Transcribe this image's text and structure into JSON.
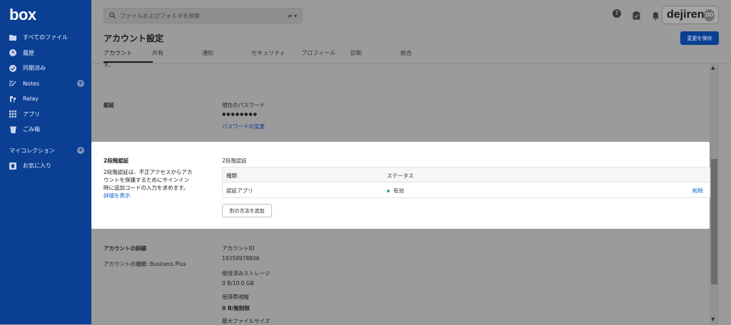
{
  "sidebar": {
    "logo": "box",
    "items": [
      {
        "label": "すべてのファイル",
        "icon": "folder-icon"
      },
      {
        "label": "履歴",
        "icon": "clock-icon"
      },
      {
        "label": "同期済み",
        "icon": "check-circle-icon"
      },
      {
        "label": "Notes",
        "icon": "notes-icon",
        "plus": true
      },
      {
        "label": "Relay",
        "icon": "relay-icon"
      },
      {
        "label": "アプリ",
        "icon": "apps-grid-icon"
      },
      {
        "label": "ごみ箱",
        "icon": "trash-icon"
      }
    ],
    "collections_label": "マイコレクション",
    "favorites_label": "お気に入り"
  },
  "header": {
    "search_placeholder": "ファイルおよびフォルダを検索",
    "brand": "dejiren",
    "avatar_initials": "DD"
  },
  "page": {
    "title": "アカウント設定",
    "save_label": "変更を保存",
    "tabs": [
      "アカウント",
      "共有",
      "通知",
      "セキュリティ",
      "プロフィール",
      "診断",
      "統合"
    ]
  },
  "content": {
    "cut_text": "す。",
    "auth_title": "認証",
    "current_password_label": "現在のパスワード",
    "password_mask": "●●●●●●●●",
    "change_password_link": "パスワードの変更",
    "account_details_title": "アカウントの詳細",
    "account_type": "アカウントの種類: Business Plus",
    "account_id_label": "アカウントID",
    "account_id": "19350978806",
    "storage_label": "使用済みストレージ",
    "storage_value": "0 B/10.0 GB",
    "bandwidth_label": "使用帯域幅",
    "bandwidth_value": "0 B/無制限",
    "max_file_label": "最大ファイルサイズ"
  },
  "two_factor": {
    "title": "2段階認証",
    "description": "2段階認証は、不正アクセスからアカウントを保護するためにサインイン時に追加コードの入力を求めます。",
    "details_link": "詳細を表示",
    "table_label": "2段階認証",
    "col_type": "種類",
    "col_status": "ステータス",
    "row_type": "認証アプリ",
    "row_status": "有効",
    "row_action": "削除",
    "add_method": "別の方法を追加"
  }
}
